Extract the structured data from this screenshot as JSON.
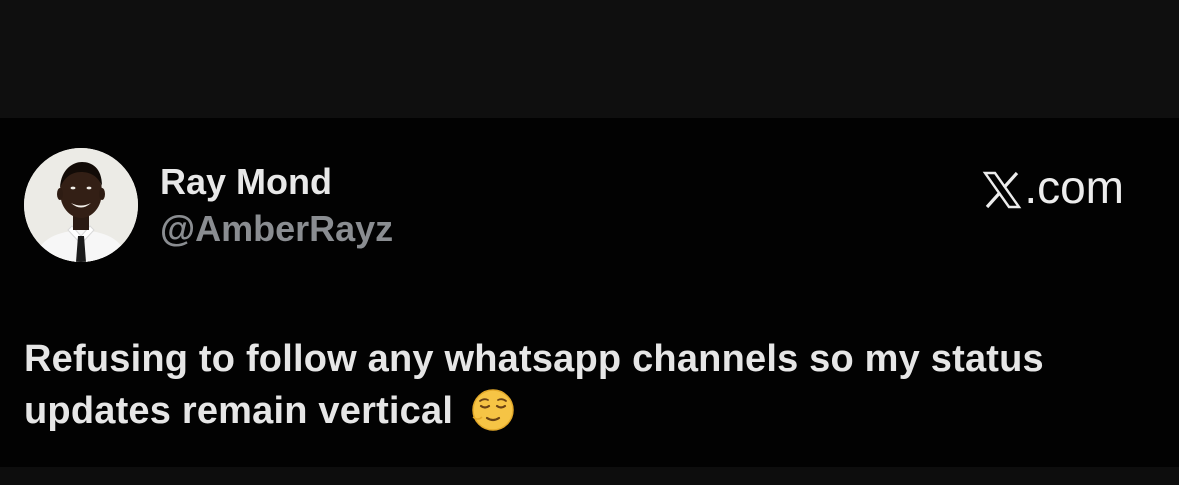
{
  "tweet": {
    "display_name": "Ray Mond",
    "handle": "@AmberRayz",
    "brand": ".com",
    "brand_logo": "x-logo-icon",
    "text": "Refusing to follow any whatsapp channels so my status updates remain vertical",
    "emoji": "relieved-face-emoji"
  },
  "colors": {
    "background": "#020202",
    "name_text": "#e8e8e8",
    "handle_text": "#8a8d91",
    "body_text": "#e6e6e6"
  }
}
